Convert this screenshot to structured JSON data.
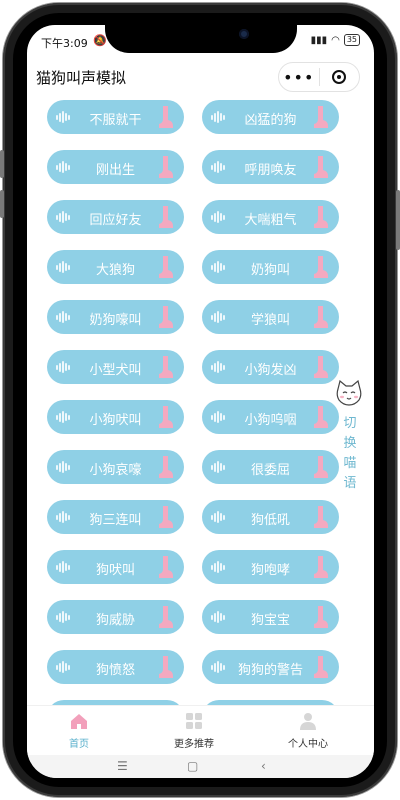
{
  "status_bar": {
    "time": "下午3:09",
    "battery": "35"
  },
  "app": {
    "title": "猫狗叫声模拟"
  },
  "sounds": [
    [
      "不服就干",
      "凶猛的狗"
    ],
    [
      "刚出生",
      "呼朋唤友"
    ],
    [
      "回应好友",
      "大喘粗气"
    ],
    [
      "大狼狗",
      "奶狗叫"
    ],
    [
      "奶狗嚎叫",
      "学狼叫"
    ],
    [
      "小型犬叫",
      "小狗发凶"
    ],
    [
      "小狗吠叫",
      "小狗呜咽"
    ],
    [
      "小狗哀嚎",
      "很委屈"
    ],
    [
      "狗三连叫",
      "狗低吼"
    ],
    [
      "狗吠叫",
      "狗咆哮"
    ],
    [
      "狗威胁",
      "狗宝宝"
    ],
    [
      "狗愤怒",
      "狗狗的警告"
    ],
    [
      "",
      ""
    ]
  ],
  "side_switch": {
    "label": "切换喵语"
  },
  "tabs": [
    {
      "label": "首页",
      "active": true
    },
    {
      "label": "更多推荐",
      "active": false
    },
    {
      "label": "个人中心",
      "active": false
    }
  ],
  "colors": {
    "pill": "#8fd0e6",
    "accent": "#5ab0cc",
    "boot": "#f4a9c0"
  }
}
